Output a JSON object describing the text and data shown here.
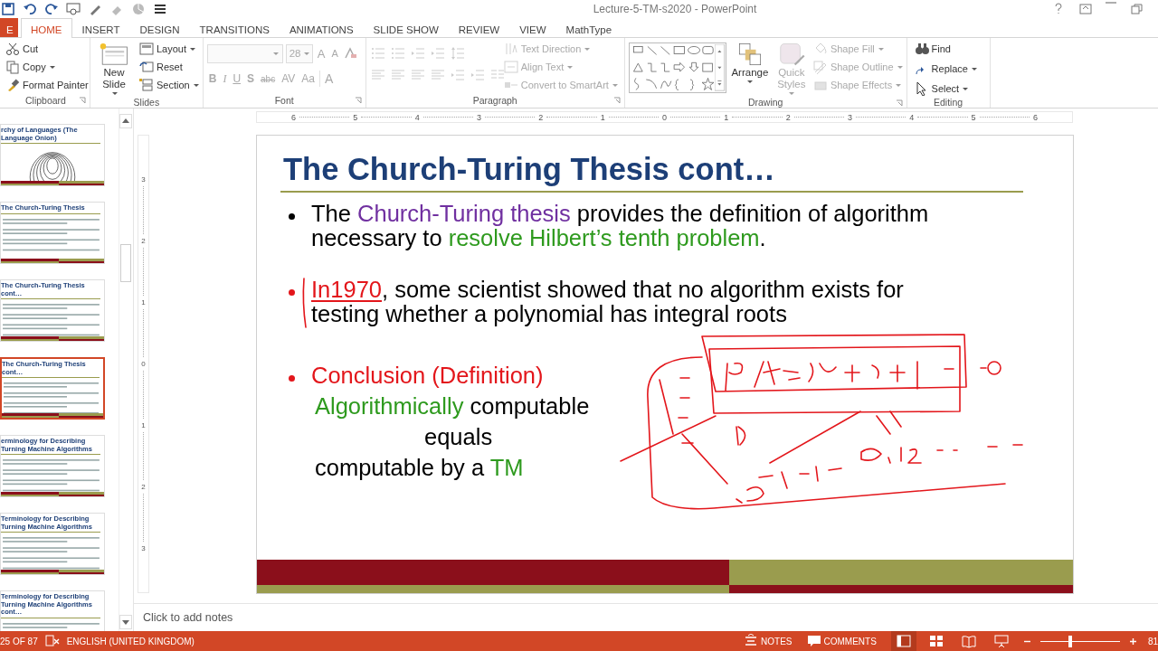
{
  "window": {
    "title": "Lecture-5-TM-s2020 - PowerPoint"
  },
  "ribbon_tabs": [
    {
      "label": "E",
      "kind": "file",
      "selected": false
    },
    {
      "label": "HOME",
      "kind": "tab",
      "selected": true
    },
    {
      "label": "INSERT",
      "kind": "tab",
      "selected": false
    },
    {
      "label": "DESIGN",
      "kind": "tab",
      "selected": false
    },
    {
      "label": "TRANSITIONS",
      "kind": "tab",
      "selected": false
    },
    {
      "label": "ANIMATIONS",
      "kind": "tab",
      "selected": false
    },
    {
      "label": "SLIDE SHOW",
      "kind": "tab",
      "selected": false
    },
    {
      "label": "REVIEW",
      "kind": "tab",
      "selected": false
    },
    {
      "label": "VIEW",
      "kind": "tab",
      "selected": false
    },
    {
      "label": "MathType",
      "kind": "tab",
      "selected": false
    }
  ],
  "clipboard": {
    "label": "Clipboard",
    "items": [
      {
        "label": "Cut",
        "disabled": false,
        "dropdown": false
      },
      {
        "label": "Copy",
        "disabled": false,
        "dropdown": true
      },
      {
        "label": "Format Painter",
        "disabled": false,
        "dropdown": false
      }
    ]
  },
  "slides_group": {
    "label": "Slides",
    "new_slide": {
      "label": "New Slide",
      "disabled": false
    },
    "items": [
      {
        "label": "Layout",
        "disabled": false,
        "dropdown": true
      },
      {
        "label": "Reset",
        "disabled": false,
        "dropdown": false
      },
      {
        "label": "Section",
        "disabled": false,
        "dropdown": true
      }
    ]
  },
  "font": {
    "label": "Font",
    "size": "28",
    "disabled": true,
    "grow_buttons": [
      "A",
      "A"
    ],
    "style_buttons": [
      "B",
      "I",
      "U",
      "S",
      "abc",
      "AV",
      "Aa"
    ],
    "color_button": "A"
  },
  "paragraph": {
    "label": "Paragraph",
    "disabled": true,
    "items": [
      {
        "label": "Text Direction",
        "disabled": true,
        "dropdown": true
      },
      {
        "label": "Align Text",
        "disabled": true,
        "dropdown": true
      },
      {
        "label": "Convert to SmartArt",
        "disabled": true,
        "dropdown": true
      }
    ]
  },
  "drawing": {
    "label": "Drawing",
    "arrange": {
      "label": "Arrange",
      "disabled": false
    },
    "quick_styles": {
      "label": "Quick Styles",
      "disabled": true
    },
    "items": [
      {
        "label": "Shape Fill",
        "disabled": true,
        "dropdown": true
      },
      {
        "label": "Shape Outline",
        "disabled": true,
        "dropdown": true
      },
      {
        "label": "Shape Effects",
        "disabled": true,
        "dropdown": true
      }
    ]
  },
  "editing": {
    "label": "Editing",
    "items": [
      {
        "label": "Find",
        "disabled": false,
        "dropdown": false
      },
      {
        "label": "Replace",
        "disabled": false,
        "dropdown": true
      },
      {
        "label": "Select",
        "disabled": false,
        "dropdown": true
      }
    ]
  },
  "thumbnails": [
    {
      "title": "rchy of Languages (The Language Onion)",
      "kind": "onion",
      "selected": false
    },
    {
      "title": "The Church-Turing Thesis",
      "kind": "text",
      "selected": false
    },
    {
      "title": "The Church-Turing Thesis cont…",
      "kind": "text",
      "selected": false
    },
    {
      "title": "The Church-Turing Thesis cont…",
      "kind": "text",
      "selected": true
    },
    {
      "title": "erminology for Describing Turning Machine Algorithms",
      "kind": "text",
      "selected": false
    },
    {
      "title": "Terminology for Describing Turning Machine Algorithms",
      "kind": "text",
      "selected": false
    },
    {
      "title": "Terminology for Describing Turning Machine Algorithms cont…",
      "kind": "text",
      "selected": false
    }
  ],
  "ruler": {
    "horizontal": [
      "6",
      "5",
      "4",
      "3",
      "2",
      "1",
      "0",
      "1",
      "2",
      "3",
      "4",
      "5",
      "6"
    ],
    "vertical": [
      "3",
      "2",
      "1",
      "0",
      "1",
      "2",
      "3"
    ]
  },
  "slide": {
    "title": "The Church-Turing Thesis cont…",
    "bullets": [
      {
        "color": "#000000",
        "segments": [
          {
            "text": "The ",
            "color": "#000000"
          },
          {
            "text": "Church-Turing thesis",
            "color": "#7030a0"
          },
          {
            "text": " provides the definition of algorithm necessary to ",
            "color": "#000000"
          },
          {
            "text": "resolve Hilbert’s tenth problem",
            "color": "#2e9a1e"
          },
          {
            "text": ".",
            "color": "#000000"
          }
        ]
      },
      {
        "color": "#e3161b",
        "segments": [
          {
            "text": "In1970",
            "color": "#e3161b",
            "underlined": true
          },
          {
            "text": ", some scientist showed that no algorithm exists for testing whether a polynomial has integral roots",
            "color": "#000000"
          }
        ]
      },
      {
        "color": "#e3161b",
        "segments": [
          {
            "text": "Conclusion (Definition)",
            "color": "#e3161b"
          }
        ],
        "lines": [
          {
            "kind": "line",
            "segments": [
              {
                "text": "Algorithmically",
                "color": "#2e9a1e"
              },
              {
                "text": " computable",
                "color": "#000000"
              }
            ]
          },
          {
            "kind": "centered",
            "segments": [
              {
                "text": "equals",
                "color": "#000000"
              }
            ]
          },
          {
            "kind": "line",
            "segments": [
              {
                "text": "computable by a ",
                "color": "#000000"
              },
              {
                "text": "TM",
                "color": "#2e9a1e"
              }
            ]
          }
        ]
      }
    ]
  },
  "notes": {
    "placeholder": "Click to add notes"
  },
  "status_bar": {
    "slide_counter": "25 OF 87",
    "language": "ENGLISH (UNITED KINGDOM)",
    "notes": "NOTES",
    "comments": "COMMENTS",
    "views": [
      {
        "selected": true
      },
      {
        "selected": false
      },
      {
        "selected": false
      },
      {
        "selected": false
      }
    ],
    "zoom": {
      "level": 0.38,
      "reading": "81"
    }
  }
}
